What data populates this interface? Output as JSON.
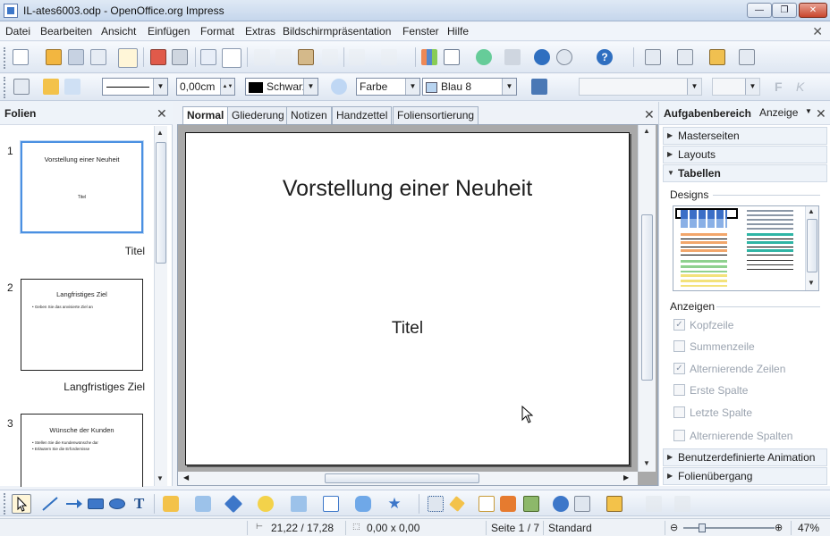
{
  "window": {
    "title": "IL-ates6003.odp - OpenOffice.org Impress",
    "min": "—",
    "max": "❐",
    "close": "✕"
  },
  "menu": [
    "Datei",
    "Bearbeiten",
    "Ansicht",
    "Einfügen",
    "Format",
    "Extras",
    "Bildschirmpräsentation",
    "Fenster",
    "Hilfe"
  ],
  "line_toolbar": {
    "line_width": "0,00cm",
    "line_color": "Schwarz",
    "area_style": "Farbe",
    "area_color": "Blau 8"
  },
  "slides_pane": {
    "title": "Folien",
    "slides": [
      {
        "number": "1",
        "title": "Vorstellung einer Neuheit",
        "subtitle": "Titel",
        "label": "Titel"
      },
      {
        "number": "2",
        "title": "Langfristiges Ziel",
        "bullets": [
          "Geben Sie das anvisierte Ziel an"
        ],
        "label": "Langfristiges Ziel"
      },
      {
        "number": "3",
        "title": "Wünsche der Kunden",
        "bullets": [
          "Stellen Sie die Kundenwünsche dar",
          "Erläutern Sie die Erfordernisse"
        ],
        "label": ""
      }
    ]
  },
  "view_tabs": [
    "Normal",
    "Gliederung",
    "Notizen",
    "Handzettel",
    "Foliensortierung"
  ],
  "active_tab": "Normal",
  "slide": {
    "title": "Vorstellung einer Neuheit",
    "subtitle": "Titel"
  },
  "task_pane": {
    "title": "Aufgabenbereich",
    "view_menu": "Anzeige",
    "sections": {
      "master": "Masterseiten",
      "layouts": "Layouts",
      "tables": "Tabellen",
      "animation": "Benutzerdefinierte Animation",
      "transition": "Folienübergang"
    },
    "designs_label": "Designs",
    "show_label": "Anzeigen",
    "options": [
      {
        "label": "Kopfzeile",
        "checked": true
      },
      {
        "label": "Summenzeile",
        "checked": false
      },
      {
        "label": "Alternierende Zeilen",
        "checked": true
      },
      {
        "label": "Erste Spalte",
        "checked": false
      },
      {
        "label": "Letzte Spalte",
        "checked": false
      },
      {
        "label": "Alternierende Spalten",
        "checked": false
      }
    ]
  },
  "status": {
    "position": "21,22 / 17,28",
    "size": "0,00 x 0,00",
    "page": "Seite 1 / 7",
    "master": "Standard",
    "zoom": "47%"
  },
  "colors": {
    "accent": "#4a90e2",
    "line_color_swatch": "#000000",
    "area_color_swatch": "#b8d4f0"
  }
}
